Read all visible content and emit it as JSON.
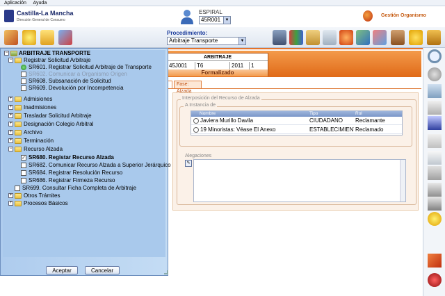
{
  "menubar": {
    "items": [
      "Aplicación",
      "Ayuda"
    ]
  },
  "header": {
    "logo_title": "Castilla-La Mancha",
    "logo_subtitle": "Dirección General de Consumo",
    "espiral_label": "ESPIRAL",
    "espiral_value": "45R001",
    "gestion_label": "Gestión Organismo"
  },
  "toolbar": {
    "procedimiento_label": "Procedimiento:",
    "procedimiento_value": "Arbitraje Transporte"
  },
  "record": {
    "title": "ARBITRAJE",
    "cells": [
      "45J001",
      "T6",
      "2011",
      "1"
    ],
    "status": "Formalizado"
  },
  "tabs": {
    "fase": "Fase: Alzada"
  },
  "alzada": {
    "fieldset_label": "Interposición del Recurso de Alzada",
    "instancia_label": "A Instancia de",
    "columns": [
      "Nombre",
      "Tipo",
      "Rol"
    ],
    "rows": [
      {
        "nombre": "Javiera Murillo Davila",
        "tipo": "CIUDADANO",
        "rol": "Reclamante"
      },
      {
        "nombre": "19 Minoristas: Véase El Anexo",
        "tipo": "ESTABLECIMIENTO",
        "rol": "Reclamado"
      }
    ],
    "alegaciones_label": "Alegaciones"
  },
  "tree": {
    "root": "ARBITRAJE TRANSPORTE",
    "registrar": "Registrar Solicitud Arbitraje",
    "sr601": "SR601. Registrar Solicitud Arbitraje de Transporte",
    "sr602": "SR602. Comunicar a Organismo Origen",
    "sr608": "SR608. Subsanación de Solicitud",
    "sr609": "SR609. Devolución por Incompetencia",
    "admisiones": "Admisiones",
    "inadmisiones": "Inadmisiones",
    "trasladar": "Trasladar Solicitud Arbitraje",
    "designacion": "Designación Colegio Arbitral",
    "archivo": "Archivo",
    "terminacion": "Terminación",
    "recurso": "Recurso Alzada",
    "sr680": "SR680. Registar Recurso Alzada",
    "sr682": "SR682. Comunicar Recurso Alzada a Superior Jerárquico",
    "sr684": "SR684. Registrar Resolución Recurso",
    "sr686": "SR686. Registrar Firmeza Recurso",
    "sr699": "SR699. Consultar Ficha Completa de Arbitraje",
    "otros": "Otros Trámites",
    "procesos": "Procesos Básicos",
    "check_mark": "✓",
    "expand_plus": "+",
    "expand_minus": "−"
  },
  "dialog": {
    "accept_label": "Aceptar",
    "cancel_label": "Cancelar"
  },
  "ui": {
    "dropdown_arrow": "▼",
    "alegaciones_button_glyph": "✎"
  },
  "colors": {
    "accent": "#e4722a",
    "tree_bg": "#a9c9ec",
    "brand_blue": "#1b2a6a"
  }
}
